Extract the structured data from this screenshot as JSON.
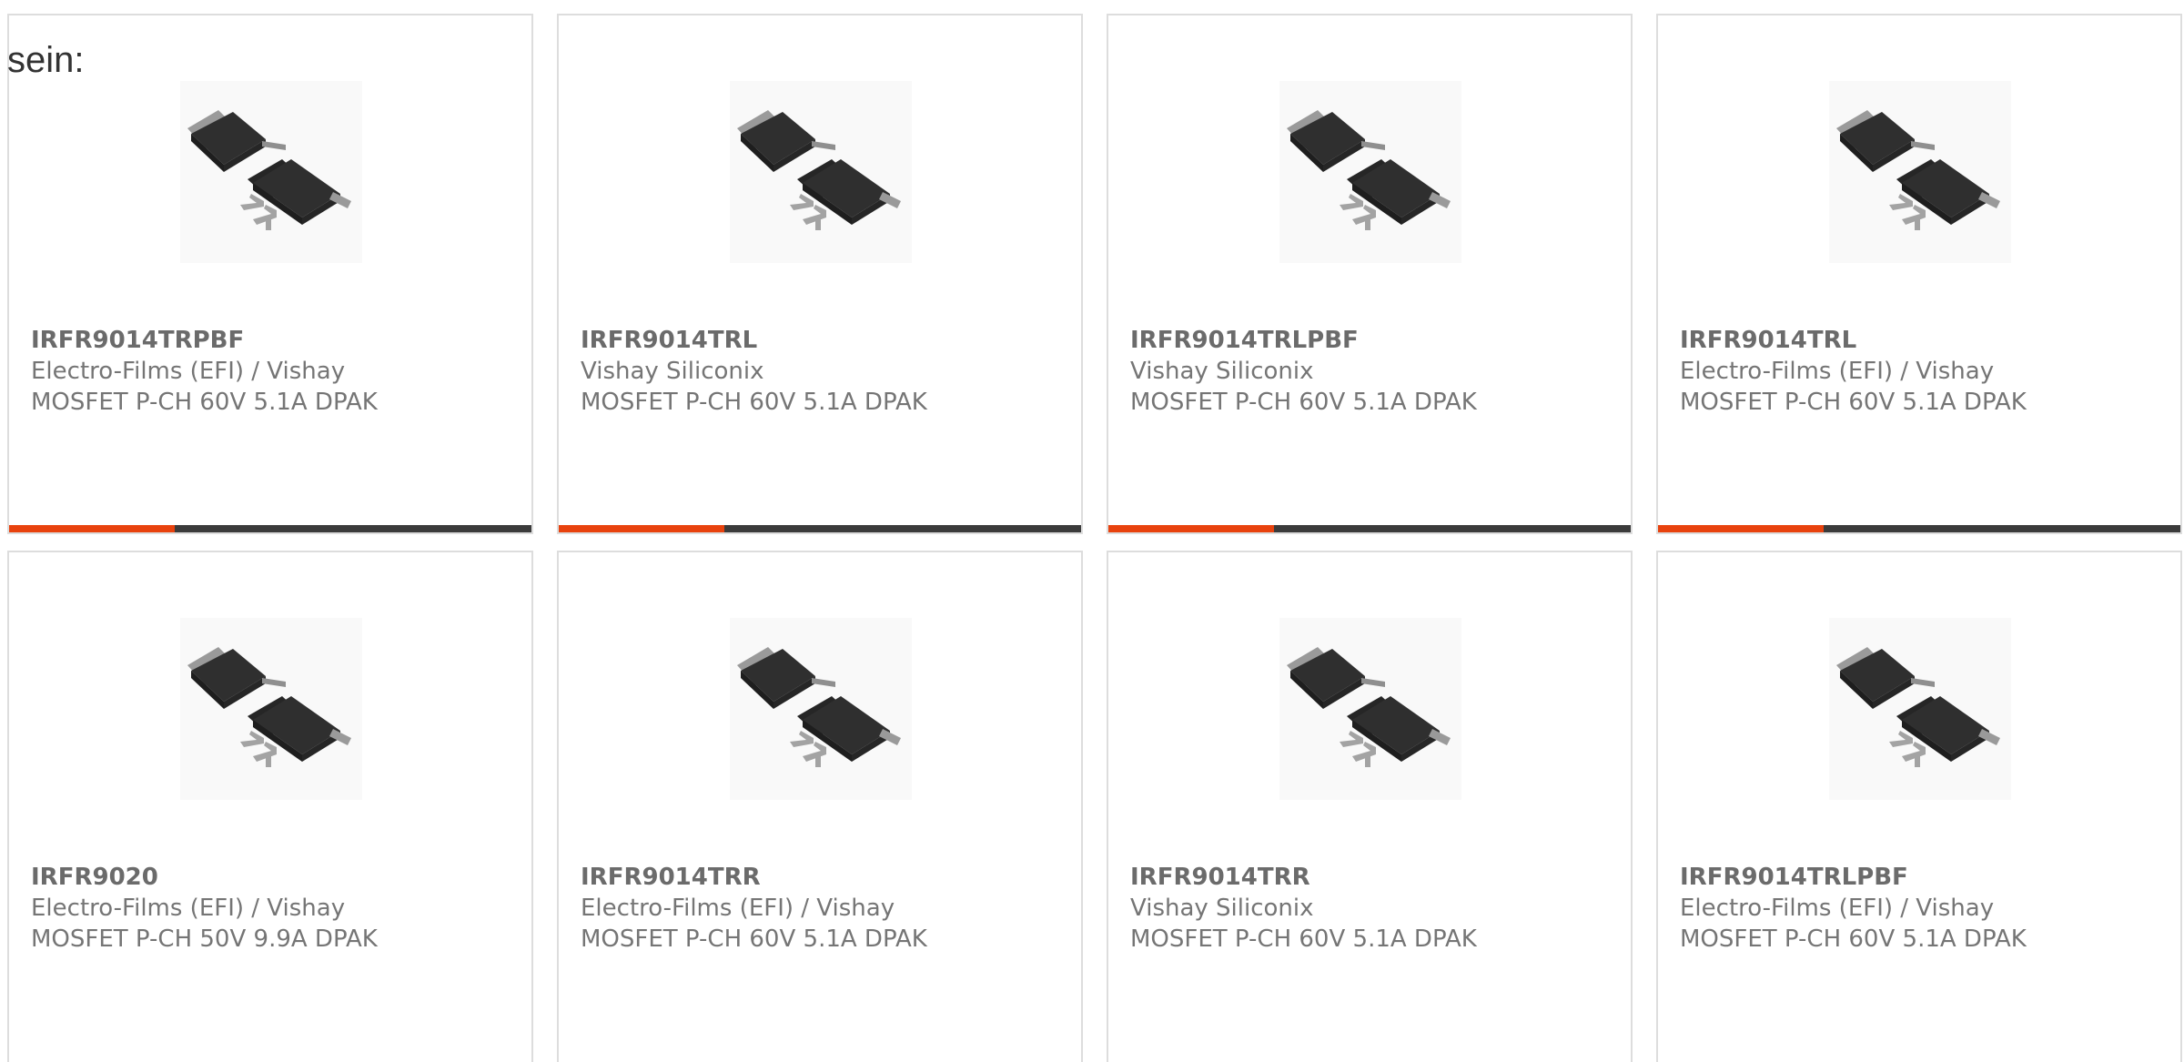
{
  "intro_text": "sein:",
  "colors": {
    "accent": "#e8420e",
    "bar_dark": "#3b3b3b",
    "border": "#dddddd",
    "text": "#757575"
  },
  "products": [
    {
      "part": "IRFR9014TRPBF",
      "manufacturer": "Electro-Films (EFI) / Vishay",
      "description": "MOSFET P-CH 60V 5.1A DPAK",
      "image_icon": "dpak-transistor-icon"
    },
    {
      "part": "IRFR9014TRL",
      "manufacturer": "Vishay Siliconix",
      "description": "MOSFET P-CH 60V 5.1A DPAK",
      "image_icon": "dpak-transistor-icon"
    },
    {
      "part": "IRFR9014TRLPBF",
      "manufacturer": "Vishay Siliconix",
      "description": "MOSFET P-CH 60V 5.1A DPAK",
      "image_icon": "dpak-transistor-icon"
    },
    {
      "part": "IRFR9014TRL",
      "manufacturer": "Electro-Films (EFI) / Vishay",
      "description": "MOSFET P-CH 60V 5.1A DPAK",
      "image_icon": "dpak-transistor-icon"
    },
    {
      "part": "IRFR9020",
      "manufacturer": "Electro-Films (EFI) / Vishay",
      "description": "MOSFET P-CH 50V 9.9A DPAK",
      "image_icon": "dpak-transistor-icon"
    },
    {
      "part": "IRFR9014TRR",
      "manufacturer": "Electro-Films (EFI) / Vishay",
      "description": "MOSFET P-CH 60V 5.1A DPAK",
      "image_icon": "dpak-transistor-icon"
    },
    {
      "part": "IRFR9014TRR",
      "manufacturer": "Vishay Siliconix",
      "description": "MOSFET P-CH 60V 5.1A DPAK",
      "image_icon": "dpak-transistor-icon"
    },
    {
      "part": "IRFR9014TRLPBF",
      "manufacturer": "Electro-Films (EFI) / Vishay",
      "description": "MOSFET P-CH 60V 5.1A DPAK",
      "image_icon": "dpak-transistor-icon"
    }
  ]
}
